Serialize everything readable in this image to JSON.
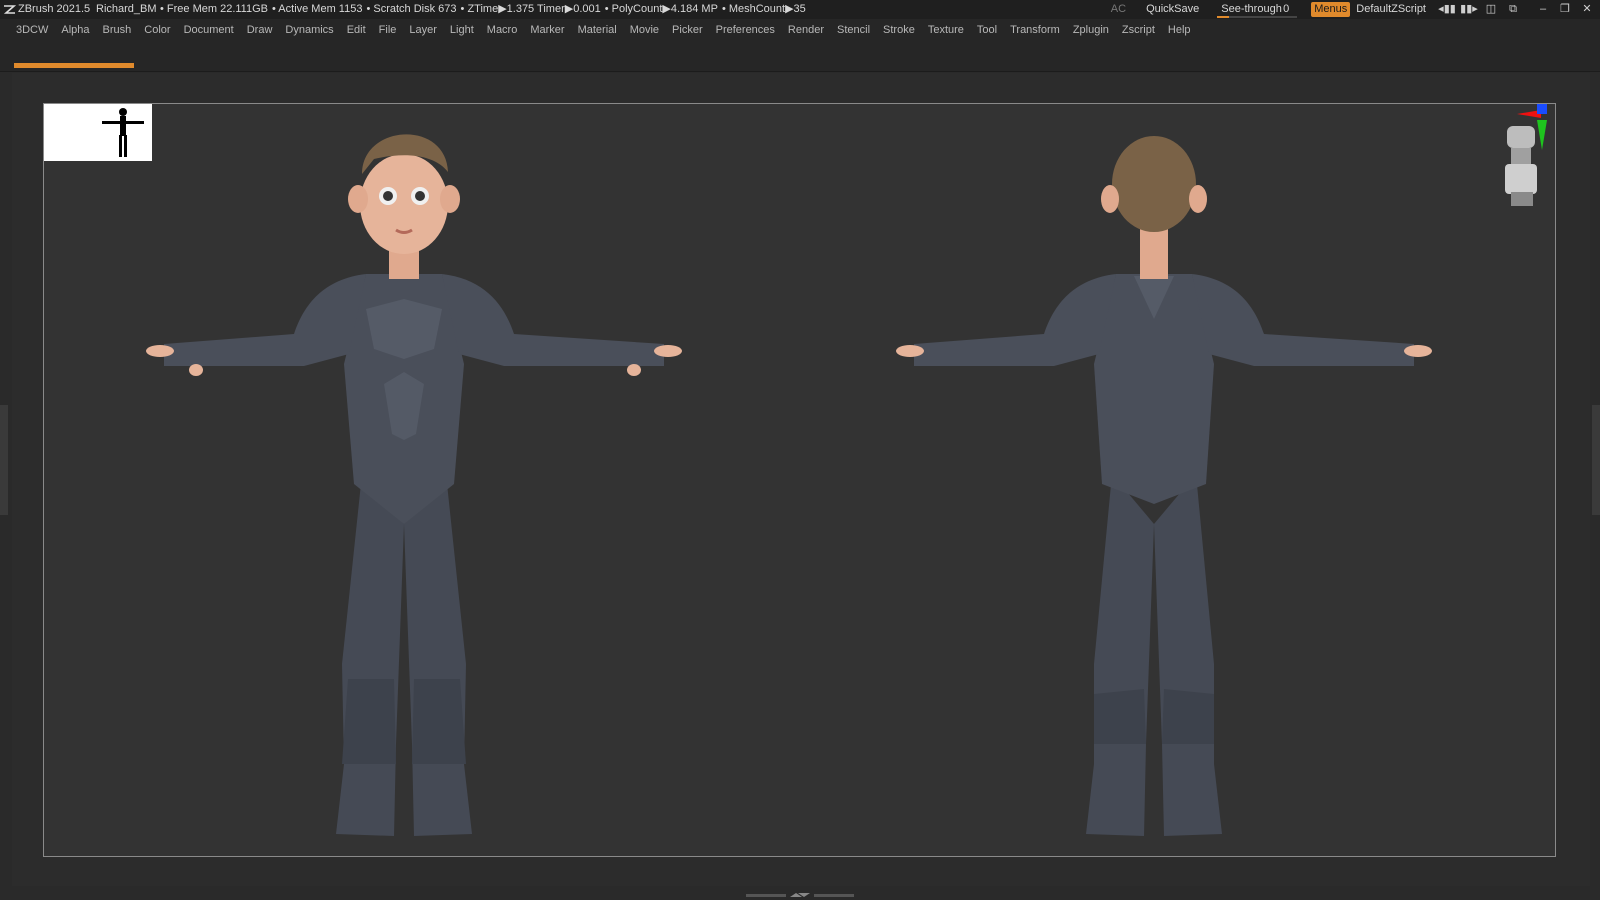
{
  "titlebar": {
    "app": "ZBrush 2021.5",
    "project": "Richard_BM",
    "stats": [
      "• Free Mem 22.111GB",
      "• Active Mem 1153",
      "• Scratch Disk 673",
      "• ZTime▶1.375 Timer▶0.001",
      "• PolyCount▶4.184 MP",
      "• MeshCount▶35"
    ],
    "ac": "AC",
    "quicksave": "QuickSave",
    "seethrough_label": "See-through",
    "seethrough_value": "0",
    "seethrough_level": 0,
    "menus": "Menus",
    "script": "DefaultZScript"
  },
  "menu": {
    "items": [
      "3DCW",
      "Alpha",
      "Brush",
      "Color",
      "Document",
      "Draw",
      "Dynamics",
      "Edit",
      "File",
      "Layer",
      "Light",
      "Macro",
      "Marker",
      "Material",
      "Movie",
      "Picker",
      "Preferences",
      "Render",
      "Stencil",
      "Stroke",
      "Texture",
      "Tool",
      "Transform",
      "Zplugin",
      "Zscript",
      "Help"
    ]
  },
  "colors": {
    "accent": "#e08a2c",
    "suit": "#4a4f5a",
    "skin": "#e6b49a",
    "hair": "#7a6247"
  },
  "icons": {
    "logo": "zbrush-logo-icon",
    "gizmo": "orientation-gizmo-icon"
  }
}
